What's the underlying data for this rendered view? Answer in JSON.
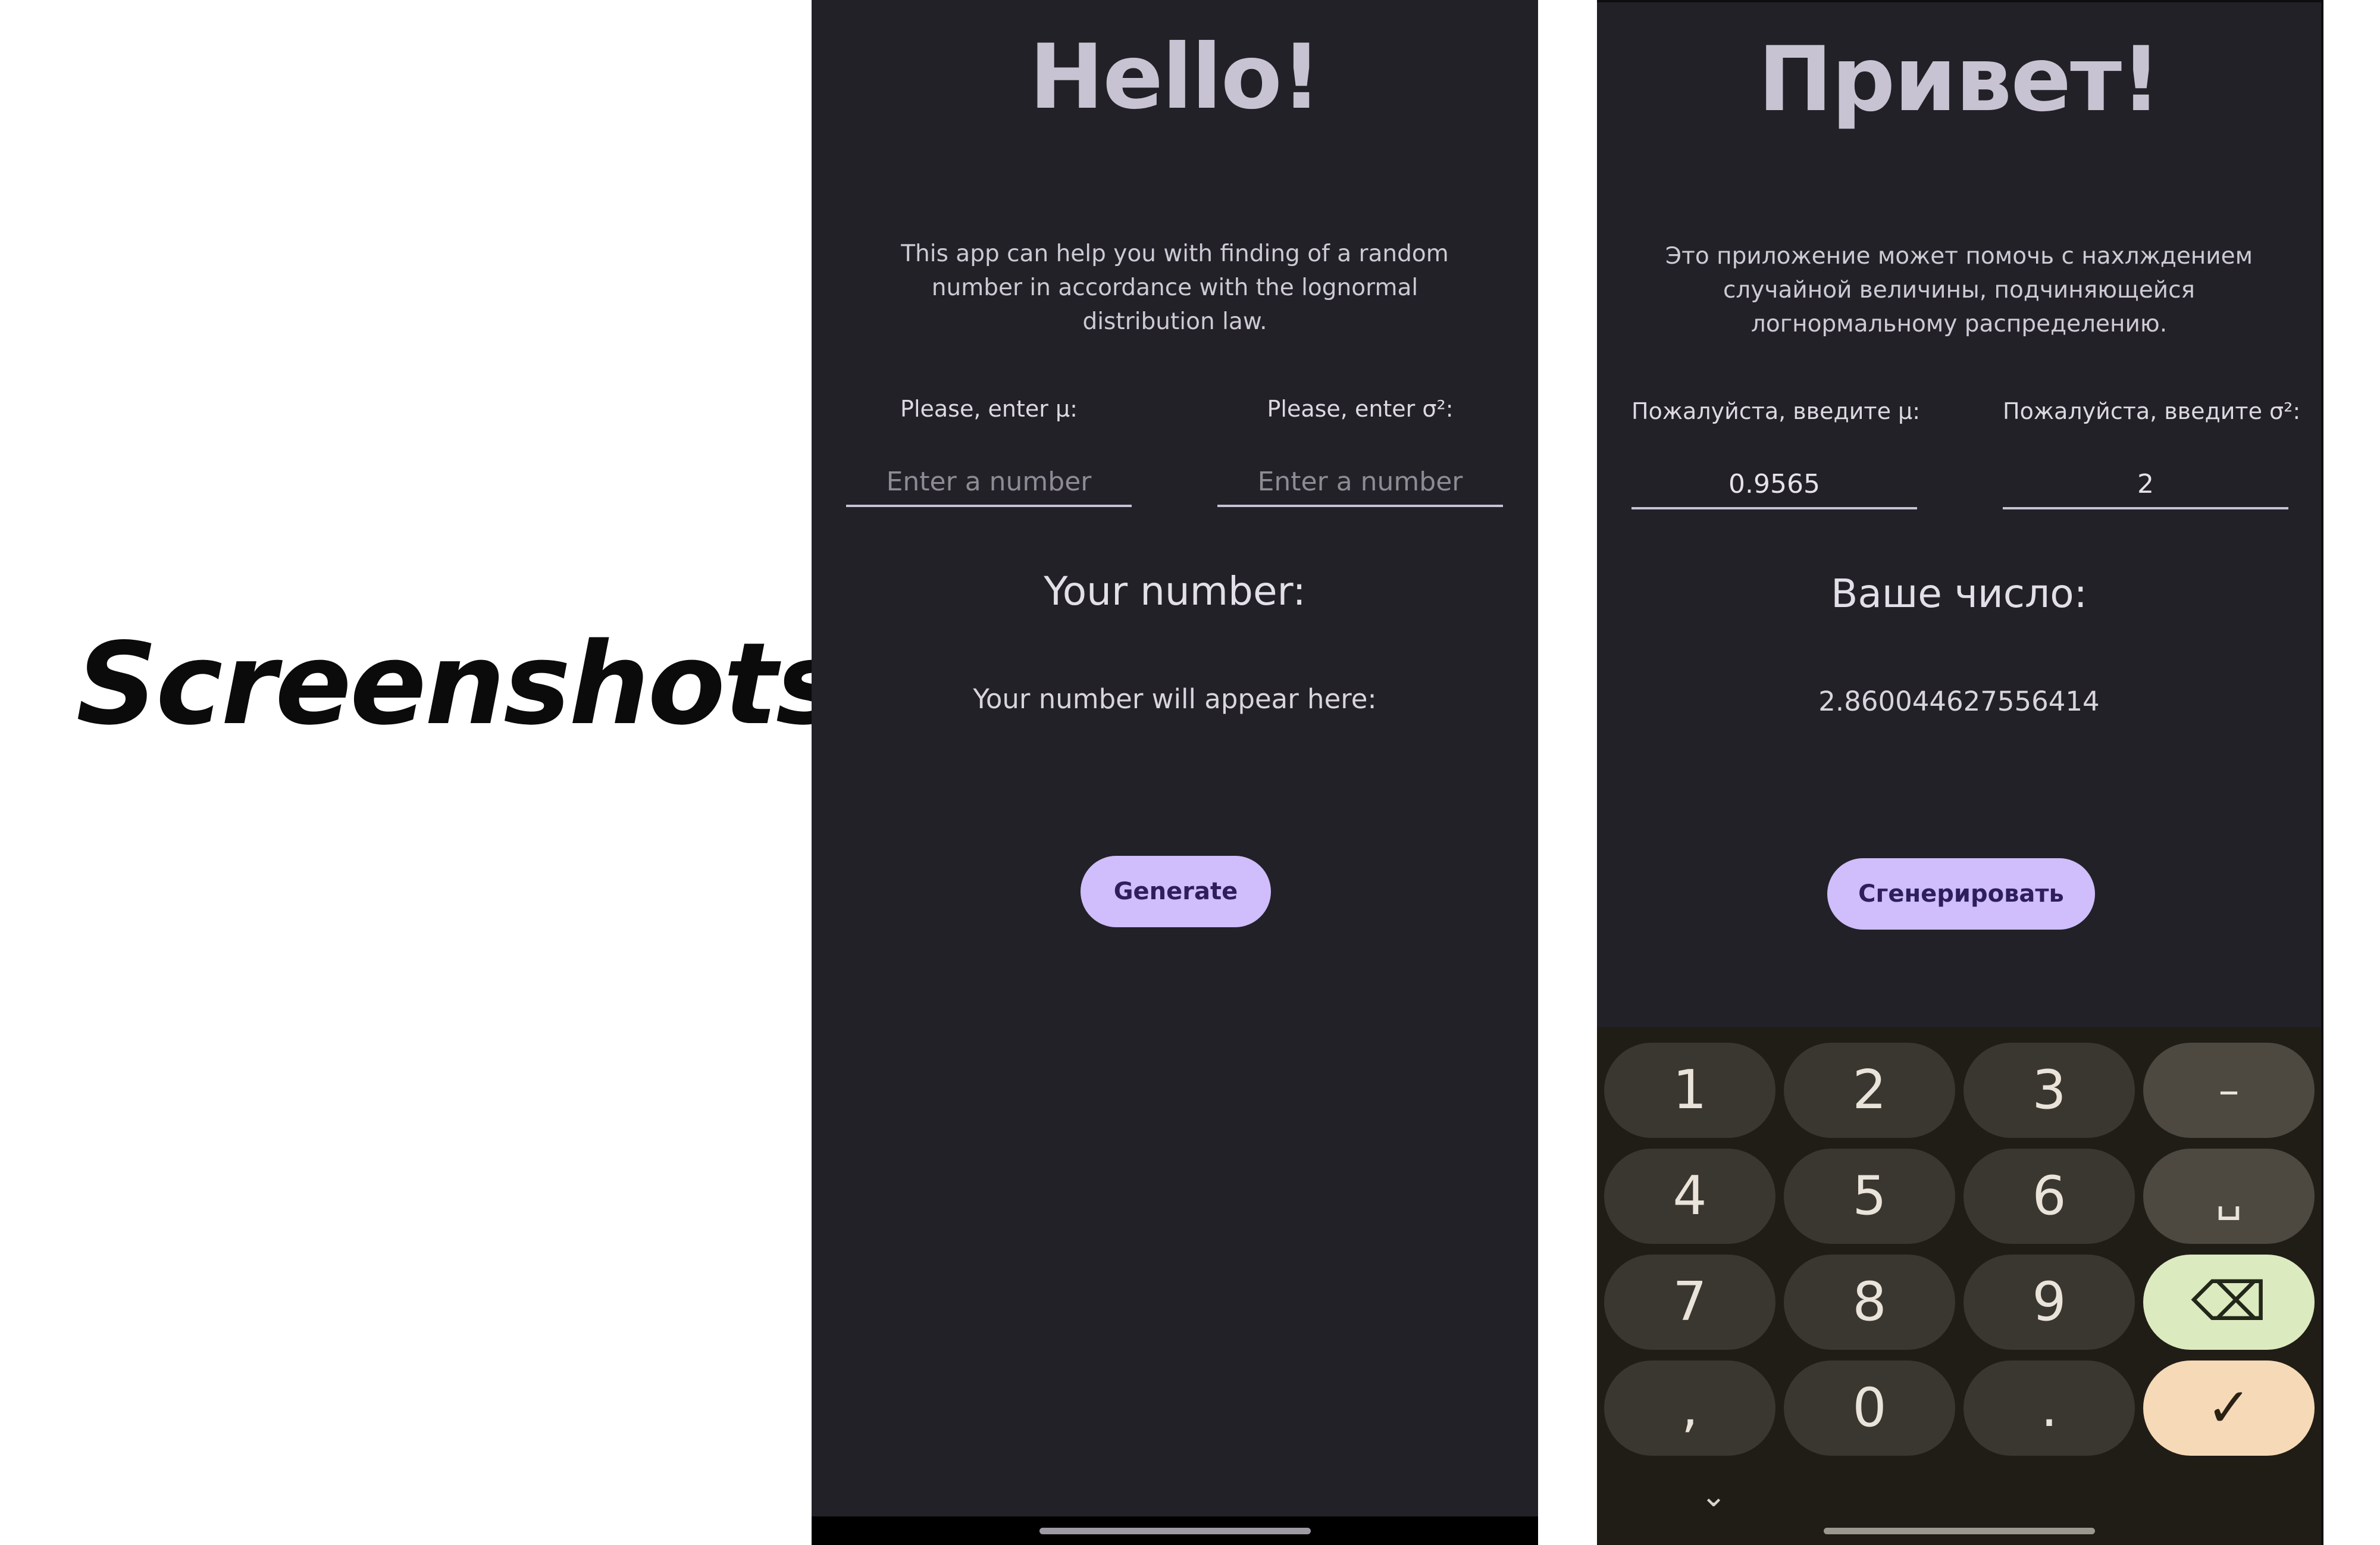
{
  "left_label": "Screenshots",
  "screen_en": {
    "greeting": "Hello!",
    "description": "This app can help you with finding of a random number in accordance with the lognormal distribution law.",
    "mu_label": "Please, enter μ:",
    "mu_placeholder": "Enter a number",
    "mu_value": "",
    "sigma_label": "Please, enter σ²:",
    "sigma_placeholder": "Enter a number",
    "sigma_value": "",
    "result_heading": "Your number:",
    "result_value": "Your number will appear here:",
    "generate_label": "Generate"
  },
  "screen_ru": {
    "greeting": "Привет!",
    "description": "Это приложение может помочь с нахлждением случайной величины, подчиняющейся логнормальному распределению.",
    "mu_label": "Пожалуйста, введите μ:",
    "mu_value": "0.9565",
    "sigma_label": "Пожалуйста, введите σ²:",
    "sigma_value": "2",
    "result_heading": "Ваше число:",
    "result_value": "2.860044627556414",
    "generate_label": "Сгенерировать"
  },
  "keyboard": {
    "rows": [
      [
        "1",
        "2",
        "3",
        "–"
      ],
      [
        "4",
        "5",
        "6",
        "␣"
      ],
      [
        "7",
        "8",
        "9",
        "⌫"
      ],
      [
        ",",
        "0",
        ".",
        "✓"
      ]
    ],
    "collapse": "⌄"
  },
  "colors": {
    "background": "#222127",
    "button": "#cfbdfc",
    "delete_key": "#dceabf",
    "confirm_key": "#f6d9b6"
  }
}
